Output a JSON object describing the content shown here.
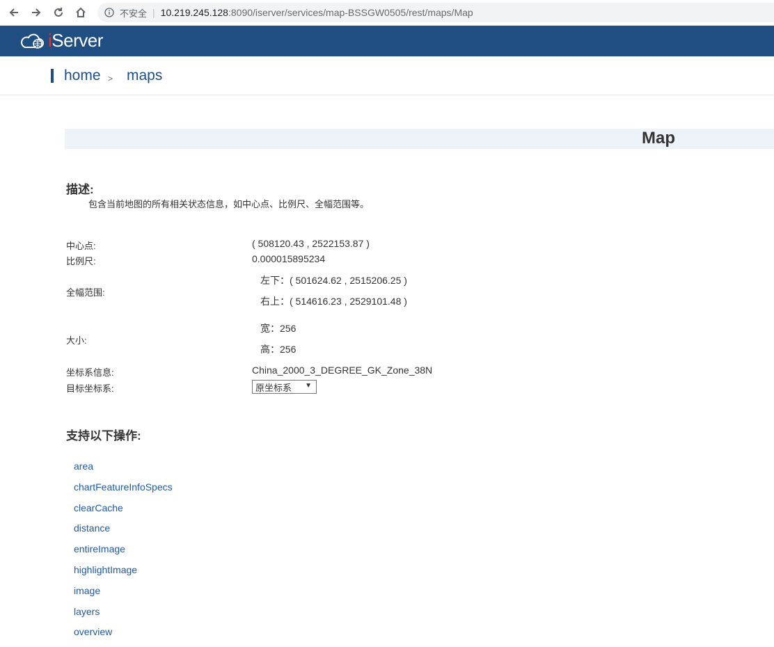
{
  "browser": {
    "insecure_label": "不安全",
    "url_host": "10.219.245.128",
    "url_rest": ":8090/iserver/services/map-BSSGW0505/rest/maps/Map"
  },
  "header": {
    "logo_i": "i",
    "logo_text": "Server"
  },
  "breadcrumb": {
    "home": "home",
    "separator": ">",
    "current": "maps"
  },
  "page": {
    "title": "Map"
  },
  "description": {
    "heading": "描述:",
    "text": "包含当前地图的所有相关状态信息，如中心点、比例尺、全幅范围等。"
  },
  "properties": {
    "center_label": "中心点:",
    "center_value": "( 508120.43 , 2522153.87 )",
    "scale_label": "比例尺:",
    "scale_value": "0.000015895234",
    "bounds_label": "全幅范围:",
    "bounds_lower": "左下：( 501624.62 , 2515206.25 )",
    "bounds_upper": "右上：( 514616.23 , 2529101.48 )",
    "size_label": "大小:",
    "size_width": "宽：256",
    "size_height": "高：256",
    "crs_label": "坐标系信息:",
    "crs_value": "China_2000_3_DEGREE_GK_Zone_38N",
    "target_crs_label": "目标坐标系:",
    "target_crs_selected": "原坐标系"
  },
  "operations": {
    "heading": "支持以下操作:",
    "items": [
      "area",
      "chartFeatureInfoSpecs",
      "clearCache",
      "distance",
      "entireImage",
      "highlightImage",
      "image",
      "layers",
      "overview"
    ]
  },
  "colors": {
    "brand": "#1f4e82",
    "link": "#1e5aa8",
    "title_bg": "#eef3fa",
    "logo_accent": "#e8322b"
  }
}
